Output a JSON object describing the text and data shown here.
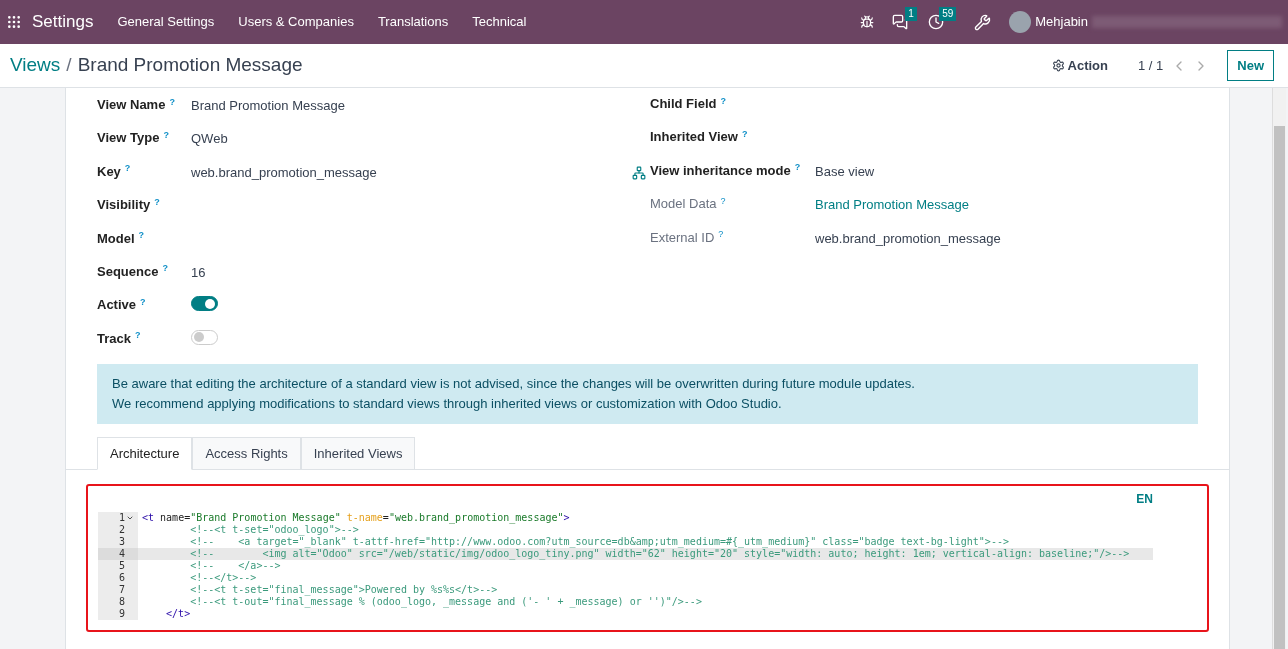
{
  "navbar": {
    "app": "Settings",
    "menus": [
      "General Settings",
      "Users & Companies",
      "Translations",
      "Technical"
    ],
    "messages_count": "1",
    "activities_count": "59",
    "user": "Mehjabin"
  },
  "control_panel": {
    "breadcrumb_parent": "Views",
    "separator": "/",
    "breadcrumb_current": "Brand Promotion Message",
    "action": "Action",
    "pager": "1 / 1",
    "new_button": "New"
  },
  "left_fields": [
    {
      "label": "View Name",
      "kind": "text",
      "value": "Brand Promotion Message"
    },
    {
      "label": "View Type",
      "kind": "text",
      "value": "QWeb"
    },
    {
      "label": "Key",
      "kind": "text-action",
      "value": "web.brand_promotion_message"
    },
    {
      "label": "Visibility",
      "kind": "empty"
    },
    {
      "label": "Model",
      "kind": "empty"
    },
    {
      "label": "Sequence",
      "kind": "text",
      "value": "16"
    },
    {
      "label": "Active",
      "kind": "toggle",
      "on": true
    },
    {
      "label": "Track",
      "kind": "toggle",
      "on": false
    }
  ],
  "help_mark": "?",
  "right_fields": [
    {
      "label": "Child Field",
      "kind": "empty",
      "muted": false
    },
    {
      "label": "Inherited View",
      "kind": "empty",
      "muted": false
    },
    {
      "label": "View inheritance mode",
      "kind": "text",
      "muted": false,
      "value": "Base view"
    },
    {
      "label": "Model Data",
      "kind": "link",
      "muted": true,
      "value": "Brand Promotion Message"
    },
    {
      "label": "External ID",
      "kind": "text",
      "muted": true,
      "value": "web.brand_promotion_message"
    }
  ],
  "alert": [
    "Be aware that editing the architecture of a standard view is not advised, since the changes will be overwritten during future module updates.",
    "We recommend applying modifications to standard views through inherited views or customization with Odoo Studio."
  ],
  "tabs": [
    {
      "label": "Architecture",
      "selected": true
    },
    {
      "label": "Access Rights",
      "selected": false
    },
    {
      "label": "Inherited Views",
      "selected": false
    }
  ],
  "editor": {
    "language": "EN",
    "lines": [
      {
        "number": "1",
        "foldable": true,
        "active": false,
        "tokens": [
          {
            "kind": "tag",
            "text": "<t"
          },
          {
            "kind": "attr",
            "text": " name"
          },
          {
            "kind": "plain",
            "text": "="
          },
          {
            "kind": "string",
            "text": "\"Brand Promotion Message\""
          },
          {
            "kind": "special",
            "text": " t-name"
          },
          {
            "kind": "plain",
            "text": "="
          },
          {
            "kind": "string",
            "text": "\"web.brand_promotion_message\""
          },
          {
            "kind": "tag",
            "text": ">"
          }
        ]
      },
      {
        "number": "2",
        "foldable": false,
        "active": false,
        "tokens": [
          {
            "kind": "comment",
            "text": "        <!--<t t-set=\"odoo_logo\">-->"
          }
        ]
      },
      {
        "number": "3",
        "foldable": false,
        "active": false,
        "tokens": [
          {
            "kind": "comment",
            "text": "        <!--    <a target=\"_blank\" t-attf-href=\"http://www.odoo.com?utm_source=db&amp;utm_medium=#{_utm_medium}\" class=\"badge text-bg-light\">-->"
          }
        ]
      },
      {
        "number": "4",
        "foldable": false,
        "active": true,
        "tokens": [
          {
            "kind": "comment",
            "text": "        <!--        <img alt=\"Odoo\" src=\"/web/static/img/odoo_logo_tiny.png\" width=\"62\" height=\"20\" style=\"width: auto; height: 1em; vertical-align: baseline;\"/>-->"
          }
        ]
      },
      {
        "number": "5",
        "foldable": false,
        "active": false,
        "tokens": [
          {
            "kind": "comment",
            "text": "        <!--    </a>-->"
          }
        ]
      },
      {
        "number": "6",
        "foldable": false,
        "active": false,
        "tokens": [
          {
            "kind": "comment",
            "text": "        <!--</t>-->"
          }
        ]
      },
      {
        "number": "7",
        "foldable": false,
        "active": false,
        "tokens": [
          {
            "kind": "comment",
            "text": "        <!--<t t-set=\"final_message\">Powered by %s%s</t>-->"
          }
        ]
      },
      {
        "number": "8",
        "foldable": false,
        "active": false,
        "tokens": [
          {
            "kind": "comment",
            "text": "        <!--<t t-out=\"final_message % (odoo_logo, _message and ('- ' + _message) or '')\"/>-->"
          }
        ]
      },
      {
        "number": "9",
        "foldable": false,
        "active": false,
        "tokens": [
          {
            "kind": "tag",
            "text": "    </t>"
          }
        ]
      }
    ]
  }
}
